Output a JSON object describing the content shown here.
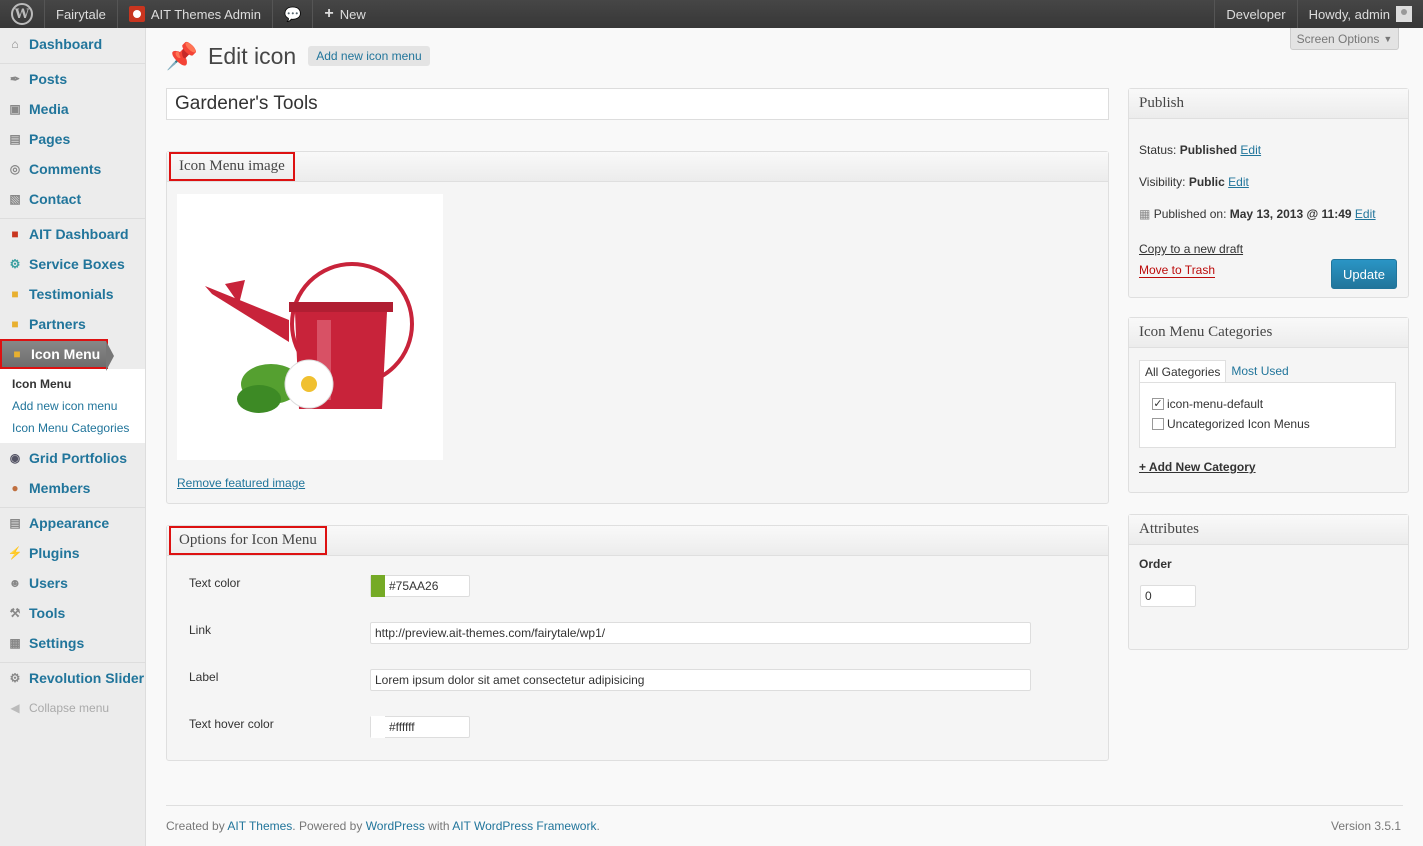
{
  "adminbar": {
    "site_name": "Fairytale",
    "ait_admin": "AIT Themes Admin",
    "new_label": "New",
    "developer": "Developer",
    "howdy": "Howdy, admin"
  },
  "sidebar": {
    "items": [
      {
        "label": "Dashboard",
        "icon": "home-icon"
      },
      {
        "label": "Posts",
        "icon": "pin-icon"
      },
      {
        "label": "Media",
        "icon": "media-icon"
      },
      {
        "label": "Pages",
        "icon": "pages-icon"
      },
      {
        "label": "Comments",
        "icon": "comment-icon"
      },
      {
        "label": "Contact",
        "icon": "contact-icon"
      },
      {
        "label": "AIT Dashboard",
        "icon": "ait-icon"
      },
      {
        "label": "Service Boxes",
        "icon": "gear-icon"
      },
      {
        "label": "Testimonials",
        "icon": "box-icon"
      },
      {
        "label": "Partners",
        "icon": "box-icon"
      },
      {
        "label": "Icon Menu",
        "icon": "box-icon"
      },
      {
        "label": "Grid Portfolios",
        "icon": "circle-icon"
      },
      {
        "label": "Members",
        "icon": "person-icon"
      },
      {
        "label": "Appearance",
        "icon": "appearance-icon"
      },
      {
        "label": "Plugins",
        "icon": "plug-icon"
      },
      {
        "label": "Users",
        "icon": "users-icon"
      },
      {
        "label": "Tools",
        "icon": "tools-icon"
      },
      {
        "label": "Settings",
        "icon": "settings-icon"
      },
      {
        "label": "Revolution Slider",
        "icon": "gear-icon"
      }
    ],
    "submenu": [
      "Icon Menu",
      "Add new icon menu",
      "Icon Menu Categories"
    ],
    "collapse": "Collapse menu"
  },
  "main": {
    "title": "Edit icon",
    "add_new": "Add new icon menu",
    "screen_options": "Screen Options",
    "post_title": "Gardener's Tools",
    "image_box_title": "Icon Menu image",
    "remove_image": "Remove featured image",
    "options_box_title": "Options for Icon Menu",
    "options": {
      "text_color_label": "Text color",
      "text_color_value": "#75AA26",
      "link_label": "Link",
      "link_value": "http://preview.ait-themes.com/fairytale/wp1/",
      "label_label": "Label",
      "label_value": "Lorem ipsum dolor sit amet  consectetur adipisicing",
      "hover_label": "Text hover color",
      "hover_value": "#ffffff"
    }
  },
  "publish": {
    "title": "Publish",
    "status_label": "Status:",
    "status_value": "Published",
    "visibility_label": "Visibility:",
    "visibility_value": "Public",
    "published_on_label": "Published on:",
    "published_on_value": "May 13, 2013 @ 11:49",
    "edit": "Edit",
    "copy_draft": "Copy to a new draft",
    "trash": "Move to Trash",
    "update": "Update"
  },
  "categories": {
    "title": "Icon Menu Categories",
    "tab_all": "All Gategories",
    "tab_used": "Most Used",
    "items": [
      {
        "label": "icon-menu-default",
        "checked": true
      },
      {
        "label": "Uncategorized Icon Menus",
        "checked": false
      }
    ],
    "add_new": "+ Add New Category"
  },
  "attributes": {
    "title": "Attributes",
    "order_label": "Order",
    "order_value": "0"
  },
  "footer": {
    "created_by": "Created by",
    "ait": "AIT Themes",
    "powered": ". Powered by",
    "wordpress": "WordPress",
    "with": "with",
    "framework": "AIT WordPress Framework",
    "dot": ".",
    "version": "Version 3.5.1"
  },
  "colors": {
    "accent": "#21759b",
    "swatch": "#75AA26",
    "highlight": "#dd1111"
  }
}
